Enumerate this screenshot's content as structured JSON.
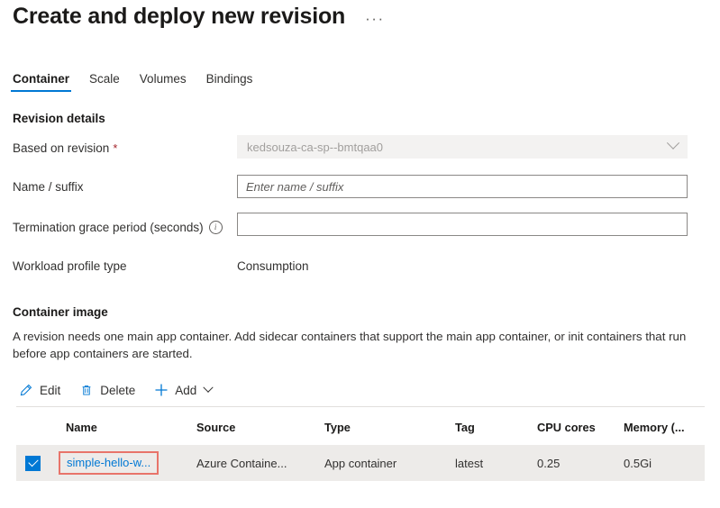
{
  "header": {
    "title": "Create and deploy new revision",
    "more_menu": "···"
  },
  "tabs": [
    {
      "label": "Container",
      "active": true
    },
    {
      "label": "Scale",
      "active": false
    },
    {
      "label": "Volumes",
      "active": false
    },
    {
      "label": "Bindings",
      "active": false
    }
  ],
  "revision_details": {
    "heading": "Revision details",
    "based_on_revision": {
      "label": "Based on revision",
      "required_marker": "*",
      "value": "kedsouza-ca-sp--bmtqaa0"
    },
    "name_suffix": {
      "label": "Name / suffix",
      "value": "",
      "placeholder": "Enter name / suffix"
    },
    "termination_grace_period": {
      "label": "Termination grace period (seconds)",
      "info_icon": "info-icon",
      "value": "",
      "placeholder": ""
    },
    "workload_profile_type": {
      "label": "Workload profile type",
      "value": "Consumption"
    }
  },
  "container_image": {
    "heading": "Container image",
    "description": "A revision needs one main app container. Add sidecar containers that support the main app container, or init containers that run before app containers are started.",
    "commands": [
      {
        "label": "Edit",
        "icon": "pencil-icon"
      },
      {
        "label": "Delete",
        "icon": "trash-icon"
      },
      {
        "label": "Add",
        "icon": "plus-icon",
        "has_caret": true
      }
    ],
    "table": {
      "columns": [
        "Name",
        "Source",
        "Type",
        "Tag",
        "CPU cores",
        "Memory (..."
      ],
      "rows": [
        {
          "selected": true,
          "name": "simple-hello-w...",
          "source": "Azure Containe...",
          "type": "App container",
          "tag": "latest",
          "cpu_cores": "0.25",
          "memory": "0.5Gi",
          "name_highlighted": true
        }
      ]
    }
  },
  "colors": {
    "accent": "#0078d4",
    "required": "#a4262c",
    "annotation": "#e8746a",
    "row_background": "#edebe9",
    "disabled_field": "#f3f2f1"
  }
}
